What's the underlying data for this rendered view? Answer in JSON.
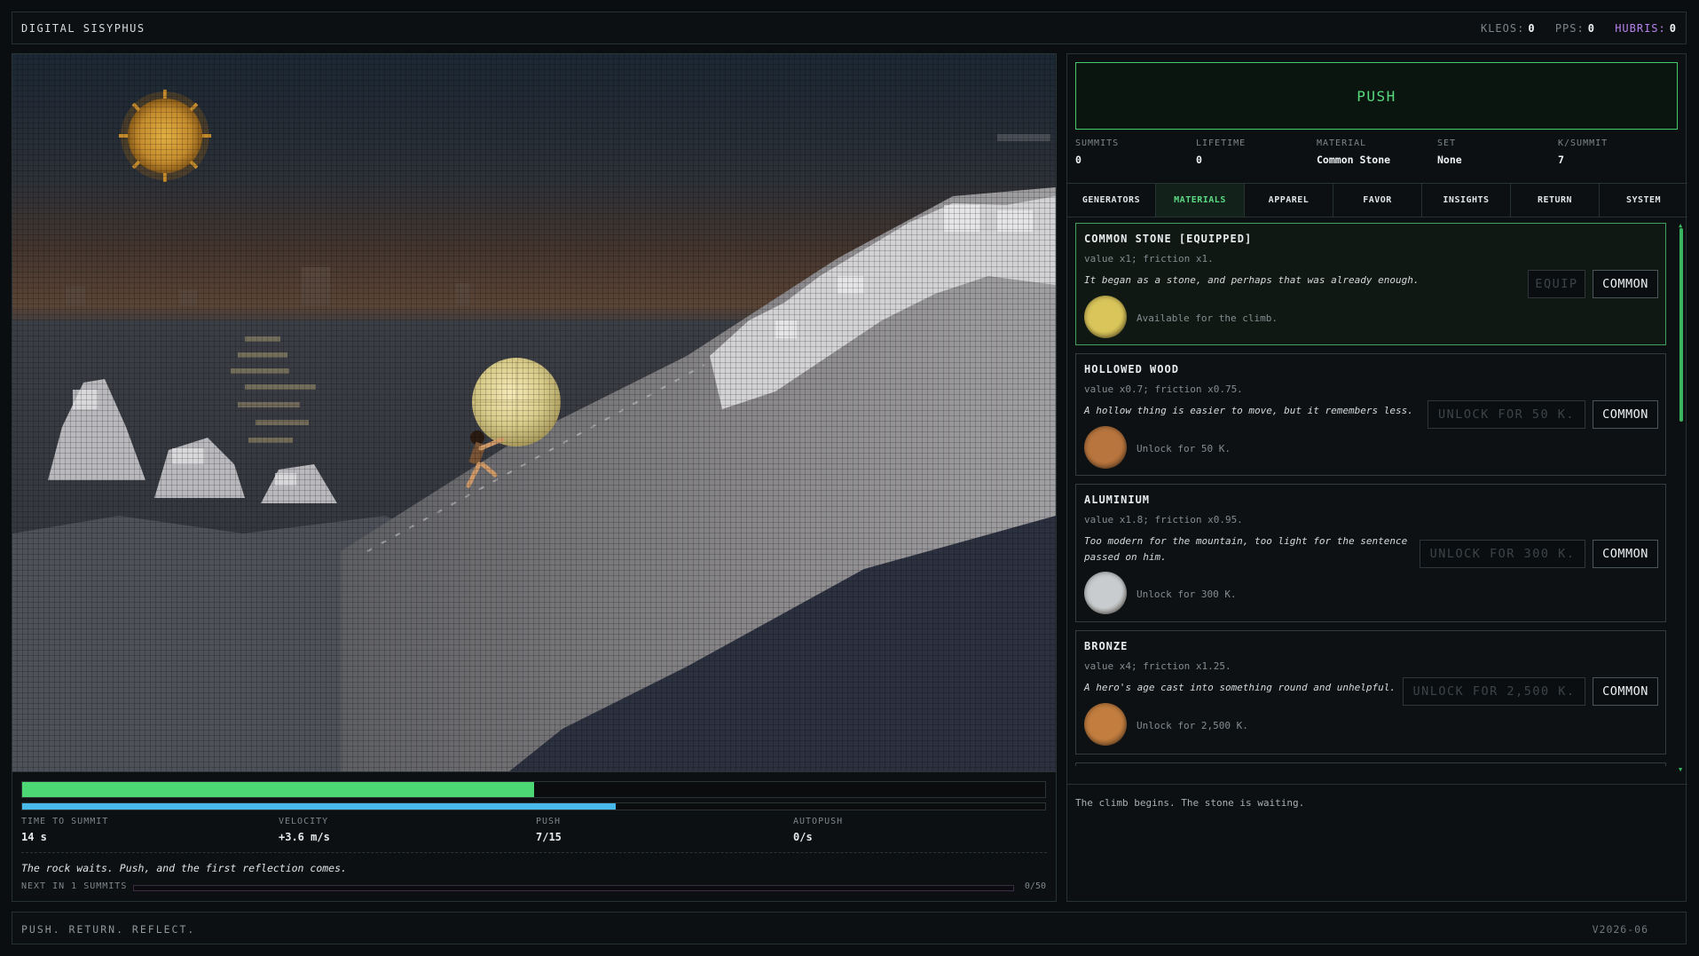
{
  "header": {
    "title": "DIGITAL SISYPHUS",
    "stats": [
      {
        "label": "KLEOS:",
        "value": "0"
      },
      {
        "label": "PPS:",
        "value": "0"
      },
      {
        "label": "HUBRIS:",
        "value": "0",
        "color": "#b882ee"
      }
    ]
  },
  "game": {
    "summit_progress": 0.5,
    "velocity_progress": 0.58,
    "metrics": [
      {
        "label": "TIME TO SUMMIT",
        "value": "14 s"
      },
      {
        "label": "VELOCITY",
        "value": "+3.6 m/s"
      },
      {
        "label": "PUSH",
        "value": "7/15"
      },
      {
        "label": "AUTOPUSH",
        "value": "0/s"
      }
    ],
    "reflection_text": "The rock waits. Push, and the first reflection comes.",
    "next_label": "NEXT IN 1 SUMMITS",
    "next_count": "0/50"
  },
  "controls": {
    "push_label": "PUSH",
    "stats": [
      {
        "label": "SUMMITS",
        "value": "0"
      },
      {
        "label": "LIFETIME",
        "value": "0"
      },
      {
        "label": "MATERIAL",
        "value": "Common Stone"
      },
      {
        "label": "SET",
        "value": "None"
      },
      {
        "label": "K/SUMMIT",
        "value": "7"
      }
    ],
    "tabs": [
      "GENERATORS",
      "MATERIALS",
      "APPAREL",
      "FAVOR",
      "INSIGHTS",
      "RETURN",
      "SYSTEM"
    ],
    "active_tab": "MATERIALS"
  },
  "materials": [
    {
      "name": "COMMON STONE [EQUIPPED]",
      "desc": "value x1; friction x1.",
      "quote": "It began as a stone, and perhaps that was already enough.",
      "status": "Available for the climb.",
      "button": "EQUIP",
      "rarity": "COMMON",
      "orb_color": "#d9c55a",
      "equipped": true
    },
    {
      "name": "HOLLOWED WOOD",
      "desc": "value x0.7; friction x0.75.",
      "quote": "A hollow thing is easier to move, but it remembers less.",
      "status": "Unlock for 50 K.",
      "button": "UNLOCK FOR 50 K.",
      "rarity": "COMMON",
      "orb_color": "#b8753e",
      "equipped": false
    },
    {
      "name": "ALUMINIUM",
      "desc": "value x1.8; friction x0.95.",
      "quote_lines": [
        "Too modern for the mountain, too light for the sentence",
        "passed on him."
      ],
      "status": "Unlock for 300 K.",
      "button": "UNLOCK FOR 300 K.",
      "rarity": "COMMON",
      "orb_color": "#c8ccce",
      "equipped": false
    },
    {
      "name": "BRONZE",
      "desc": "value x4; friction x1.25.",
      "quote": "A hero's age cast into something round and unhelpful.",
      "status": "Unlock for 2,500 K.",
      "button": "UNLOCK FOR 2,500 K.",
      "rarity": "COMMON",
      "orb_color": "#c27d3f",
      "equipped": false
    }
  ],
  "log": [
    "The climb begins. The stone is waiting."
  ],
  "footer": {
    "tagline": "PUSH. RETURN. REFLECT.",
    "version": "V2026-06"
  }
}
